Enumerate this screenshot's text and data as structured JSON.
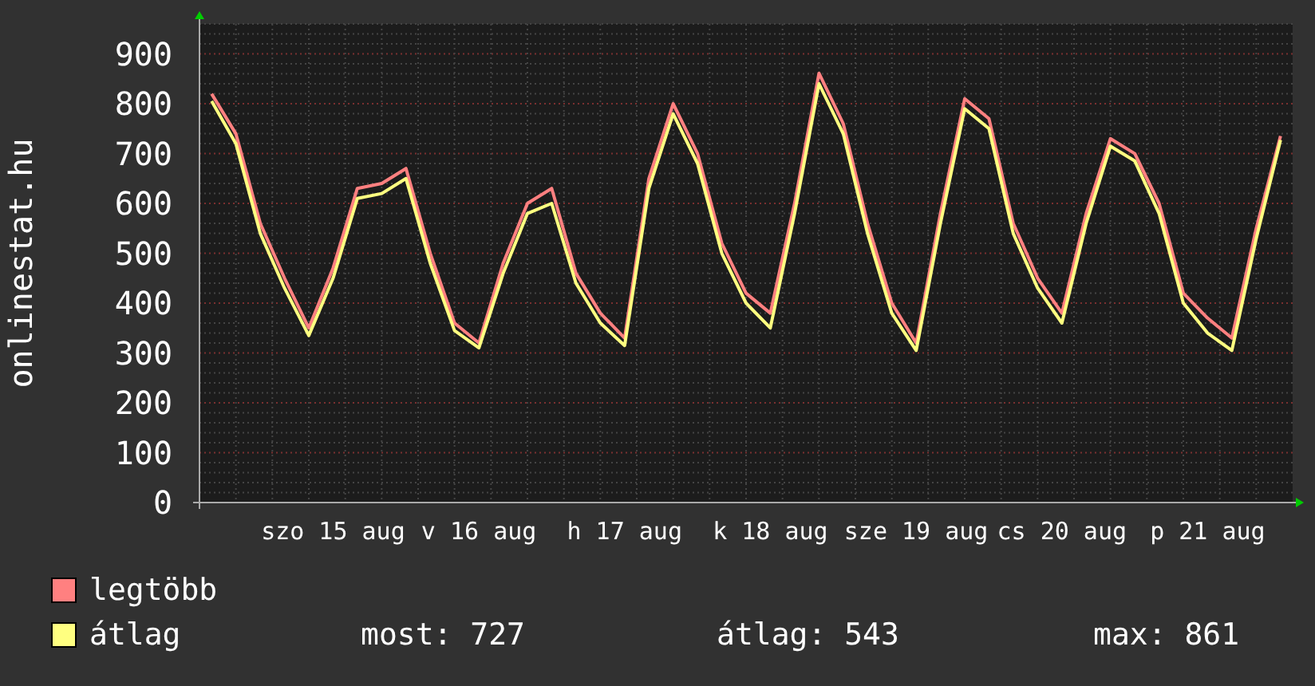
{
  "chart": {
    "chart_data": {
      "type": "line",
      "ylabel": "onlinestat.hu",
      "categories": [
        null,
        null,
        null,
        null,
        null,
        "szo 15 aug",
        null,
        null,
        null,
        null,
        null,
        "v 16 aug",
        null,
        null,
        null,
        null,
        null,
        "h 17 aug",
        null,
        null,
        null,
        null,
        null,
        "k 18 aug",
        null,
        null,
        null,
        null,
        null,
        "sze 19 aug",
        null,
        null,
        null,
        null,
        null,
        "cs 20 aug",
        null,
        null,
        null,
        null,
        null,
        "p 21 aug",
        null,
        null,
        null
      ],
      "series": [
        {
          "name": "legtöbb",
          "color": "#ff8080",
          "values": [
            820,
            740,
            560,
            450,
            350,
            470,
            630,
            640,
            670,
            500,
            360,
            320,
            480,
            600,
            630,
            460,
            380,
            330,
            650,
            800,
            700,
            520,
            420,
            380,
            600,
            861,
            760,
            560,
            400,
            320,
            580,
            810,
            770,
            560,
            450,
            380,
            580,
            730,
            700,
            600,
            420,
            370,
            330,
            550,
            735
          ]
        },
        {
          "name": "átlag",
          "color": "#ffff80",
          "values": [
            805,
            720,
            540,
            430,
            335,
            450,
            610,
            620,
            650,
            480,
            345,
            310,
            460,
            580,
            600,
            440,
            360,
            315,
            630,
            780,
            680,
            500,
            400,
            350,
            580,
            840,
            740,
            540,
            380,
            305,
            560,
            790,
            750,
            540,
            430,
            360,
            560,
            715,
            685,
            580,
            400,
            340,
            305,
            530,
            727
          ]
        }
      ],
      "grid": true,
      "ylim": [
        0,
        960
      ],
      "yticks": [
        0,
        100,
        200,
        300,
        400,
        500,
        600,
        700,
        800,
        900
      ]
    }
  },
  "legend": {
    "stats": [
      "most: 727",
      "átlag: 543",
      "max: 861"
    ]
  }
}
